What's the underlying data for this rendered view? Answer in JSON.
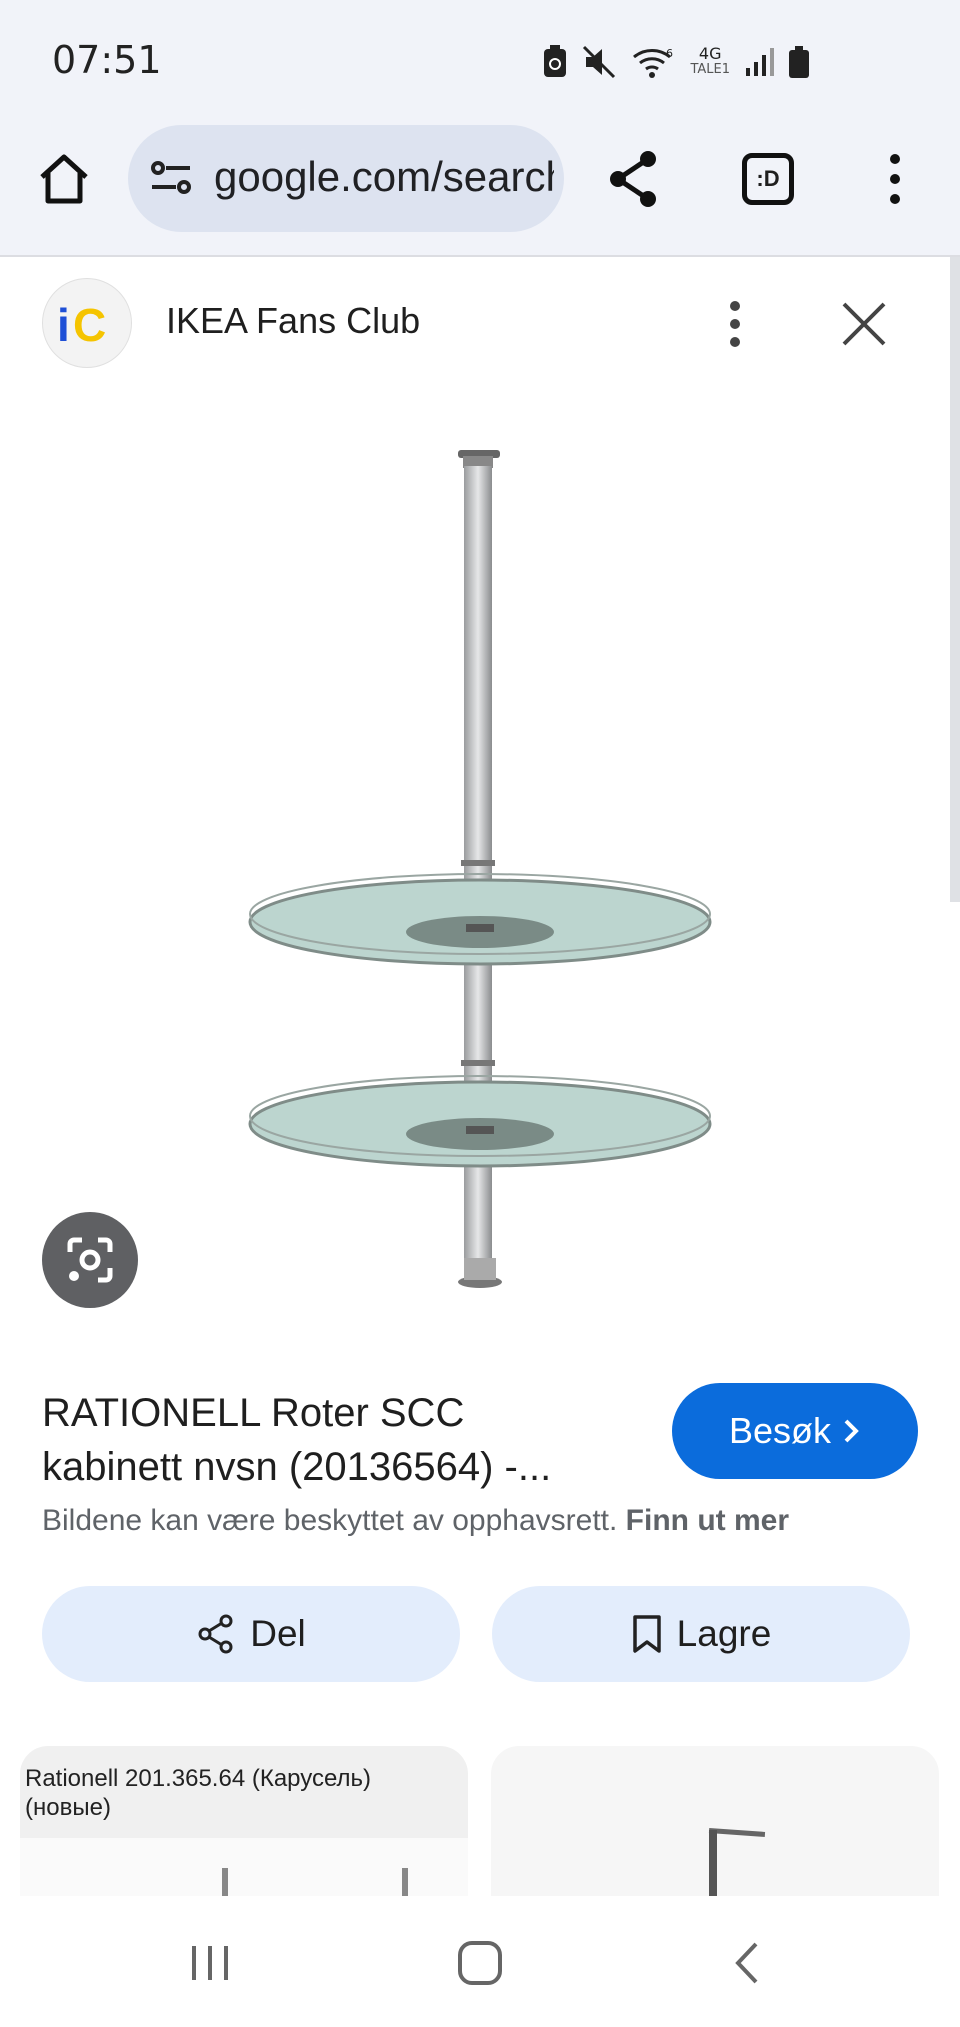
{
  "status": {
    "time": "07:51",
    "network": "4G",
    "network_sub": "TALE1"
  },
  "browser": {
    "url": "google.com/search",
    "extension_label": ":D"
  },
  "source": {
    "name": "IKEA Fans Club",
    "logo_text": "iC"
  },
  "result": {
    "title_line1": "RATIONELL Roter SCC",
    "title_line2": "kabinett nvsn (20136564) -...",
    "visit_label": "Besøk",
    "copyright_text": "Bildene kan være beskyttet av opphavsrett.",
    "copyright_link": "Finn ut mer"
  },
  "actions": {
    "share_label": "Del",
    "save_label": "Lagre"
  },
  "related": [
    {
      "caption": "Rationell 201.365.64 (Карусель)\n(новые)"
    },
    {
      "caption": ""
    }
  ],
  "colors": {
    "accent": "#0b6cdc",
    "pill_bg": "#e3edfc",
    "chrome_bg": "#f1f3f9",
    "logo_blue": "#1e4fd6",
    "logo_yellow": "#f5c400"
  }
}
